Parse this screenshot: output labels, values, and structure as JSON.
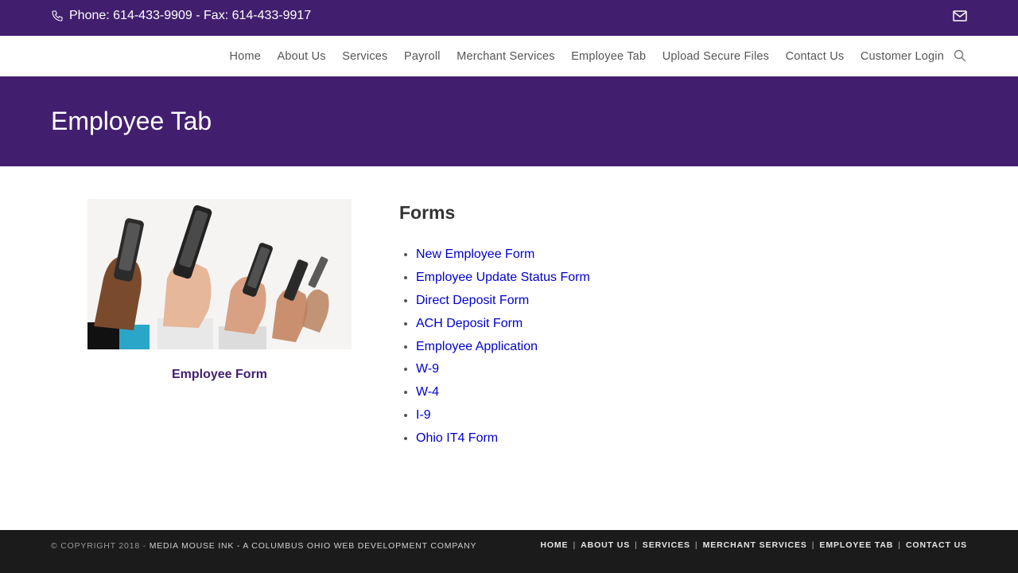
{
  "topbar": {
    "contact_text": "Phone: 614-433-9909 - Fax: 614-433-9917",
    "phone_icon": "phone-icon",
    "mail_icon": "envelope-icon",
    "background": "#421f6e"
  },
  "nav": {
    "items": [
      "Home",
      "About Us",
      "Services",
      "Payroll",
      "Merchant Services",
      "Employee Tab",
      "Upload Secure Files",
      "Contact Us",
      "Customer Login"
    ],
    "search_icon": "search-icon"
  },
  "page": {
    "title": "Employee Tab"
  },
  "sidebar": {
    "image_alt": "hands holding mobile phones",
    "caption": "Employee Form"
  },
  "forms": {
    "title": "Forms",
    "items": [
      "New Employee Form",
      "Employee Update Status Form",
      "Direct Deposit Form",
      "ACH Deposit Form",
      "Employee Application",
      "W-9",
      "W-4",
      "I-9",
      "Ohio IT4 Form"
    ],
    "link_color": "#0000cc"
  },
  "footer": {
    "copyright_prefix": "© COPYRIGHT 2018 - ",
    "copyright_brand": "MEDIA MOUSE INK - A COLUMBUS OHIO WEB DEVELOPMENT COMPANY",
    "links": [
      "HOME",
      "ABOUT US",
      "SERVICES",
      "MERCHANT SERVICES",
      "EMPLOYEE TAB",
      "CONTACT US"
    ],
    "separator": "|"
  }
}
